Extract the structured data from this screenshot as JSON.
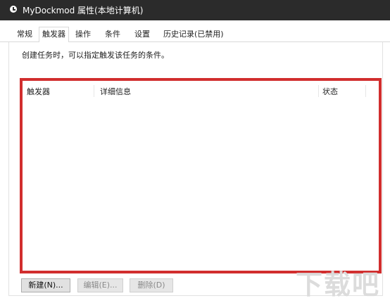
{
  "window": {
    "title": "MyDockmod 属性(本地计算机)",
    "icon": "clock-icon"
  },
  "tabs": [
    {
      "label": "常规",
      "active": false
    },
    {
      "label": "触发器",
      "active": true
    },
    {
      "label": "操作",
      "active": false
    },
    {
      "label": "条件",
      "active": false
    },
    {
      "label": "设置",
      "active": false
    },
    {
      "label": "历史记录(已禁用)",
      "active": false
    }
  ],
  "main": {
    "description": "创建任务时，可以指定触发该任务的条件。",
    "columns": [
      "触发器",
      "详细信息",
      "状态"
    ],
    "rows": []
  },
  "buttons": {
    "new_label": "新建(N)...",
    "edit_label": "编辑(E)...",
    "delete_label": "删除(D)"
  },
  "colors": {
    "titlebar": "#2b2b2b",
    "highlight": "#d12e2e"
  },
  "watermark": {
    "text": "下载吧"
  }
}
